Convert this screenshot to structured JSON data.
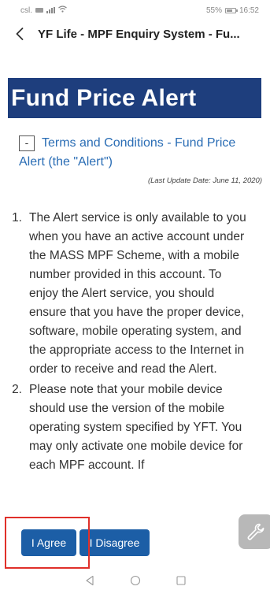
{
  "status_bar": {
    "carrier": "csl.",
    "battery": "55%",
    "time": "16:52"
  },
  "header": {
    "title": "YF Life - MPF Enquiry System - Fu..."
  },
  "banner": {
    "title": "Fund Price Alert"
  },
  "terms": {
    "collapse_symbol": "-",
    "heading": "Terms and Conditions - Fund Price Alert (the \"Alert\")",
    "last_update": "(Last Update Date:  June 11, 2020)",
    "items": [
      {
        "number": "1.",
        "text": "The Alert service is only available to you when you have an active account under the MASS MPF Scheme, with a mobile number provided in this account. To enjoy the Alert service, you should ensure that you have the proper device, software, mobile operating system, and the appropriate access to the Internet in order to receive and read the Alert."
      },
      {
        "number": "2.",
        "text": "Please note that your mobile device should use the version of the mobile operating system specified by YFT. You may only activate one mobile device for each MPF account. If"
      }
    ]
  },
  "actions": {
    "agree_label": "I Agree",
    "disagree_label": "I Disagree"
  },
  "icons": {
    "back": "chevron-left-icon",
    "wrench": "wrench-icon",
    "nav_back": "triangle-back-icon",
    "nav_home": "circle-home-icon",
    "nav_recent": "square-recent-icon"
  },
  "colors": {
    "banner_bg": "#1e3e7d",
    "button_bg": "#1c5ea6",
    "link": "#2a6db5",
    "highlight": "#e0302a"
  }
}
